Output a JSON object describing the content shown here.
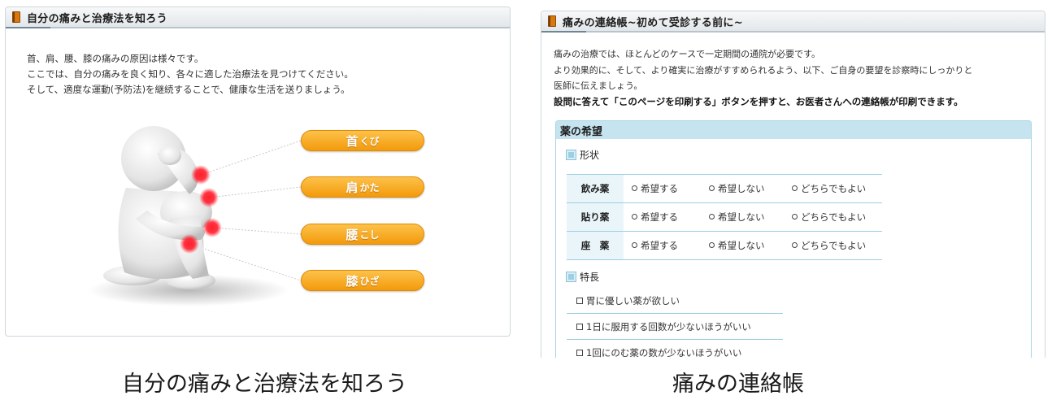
{
  "left_panel": {
    "title": "自分の痛みと治療法を知ろう",
    "intro": [
      "首、肩、腰、膝の痛みの原因は様々です。",
      "ここでは、自分の痛みを良く知り、各々に適した治療法を見つけてください。",
      "そして、適度な運動(予防法)を継続することで、健康な生活を送りましょう。"
    ],
    "buttons": [
      {
        "kanji": "首",
        "kana": "くび"
      },
      {
        "kanji": "肩",
        "kana": "かた"
      },
      {
        "kanji": "腰",
        "kana": "こし"
      },
      {
        "kanji": "膝",
        "kana": "ひざ"
      }
    ],
    "pill_color": "#f7a51c",
    "pain_dot_color": "#ff1f2d"
  },
  "right_panel": {
    "title": "痛みの連絡帳~初めて受診する前に~",
    "desc": [
      "痛みの治療では、ほとんどのケースで一定期間の通院が必要です。",
      "より効果的に、そして、より確実に治療がすすめられるよう、以下、ご自身の要望を診察時にしっかりと",
      "医師に伝えましょう。"
    ],
    "desc_bold": "設問に答えて「このページを印刷する」ボタンを押すと、お医者さんへの連絡帳が印刷できます。",
    "prefs_title": "薬の希望",
    "section_form": "形状",
    "form_rows": [
      {
        "label": "飲み薬",
        "options": [
          "希望する",
          "希望しない",
          "どちらでもよい"
        ]
      },
      {
        "label": "貼り薬",
        "options": [
          "希望する",
          "希望しない",
          "どちらでもよい"
        ]
      },
      {
        "label": "座　薬",
        "options": [
          "希望する",
          "希望しない",
          "どちらでもよい"
        ]
      }
    ],
    "section_features": "特長",
    "features": [
      "胃に優しい薬が欲しい",
      "1日に服用する回数が少ないほうがいい",
      "1回にのむ薬の数が少ないほうがいい"
    ],
    "accent_color": "#c6e4f0"
  },
  "captions": {
    "left": "自分の痛みと治療法を知ろう",
    "right": "痛みの連絡帳"
  }
}
